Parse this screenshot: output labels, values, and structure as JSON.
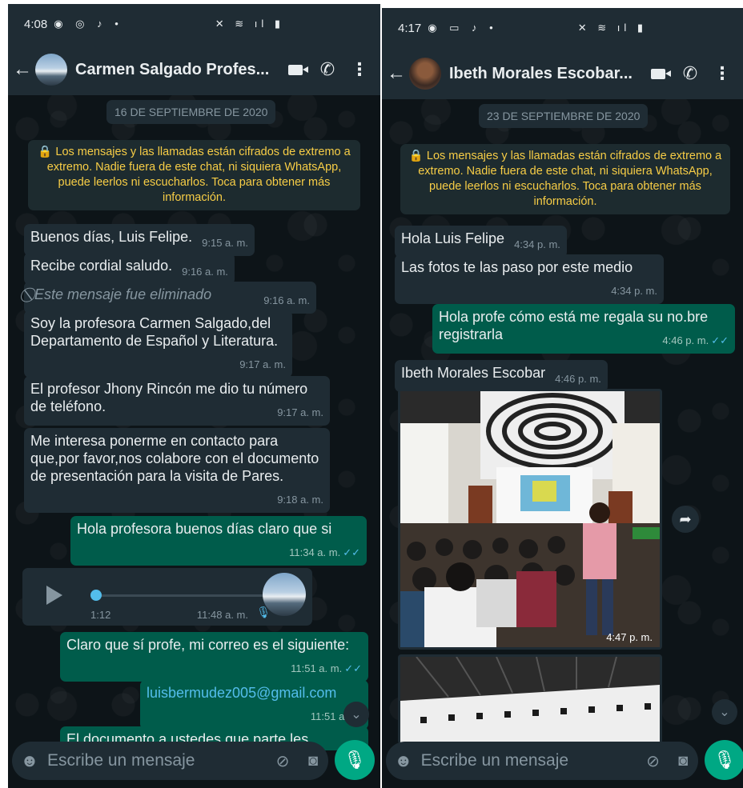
{
  "left": {
    "status_time": "4:08",
    "contact_name": "Carmen Salgado Profes...",
    "date_label": "16 DE SEPTIEMBRE DE 2020",
    "encryption_note": "🔒 Los mensajes y las llamadas están cifrados de extremo a extremo. Nadie fuera de este chat, ni siquiera WhatsApp, puede leerlos ni escucharlos. Toca para obtener más información.",
    "messages": [
      {
        "dir": "in",
        "text": "Buenos días, Luis Felipe.",
        "time": "9:15 a. m."
      },
      {
        "dir": "in",
        "text": "Recibe cordial saludo.",
        "time": "9:16 a. m."
      },
      {
        "dir": "in",
        "text": "⃠ Este mensaje fue eliminado",
        "time": "9:16 a. m."
      },
      {
        "dir": "in",
        "text": "Soy la profesora Carmen Salgado,del Departamento de Español y Literatura.",
        "time": "9:17 a. m."
      },
      {
        "dir": "in",
        "text": "El profesor Jhony Rincón me dio tu número de teléfono.",
        "time": "9:17 a. m."
      },
      {
        "dir": "in",
        "text": "Me interesa ponerme en contacto para que,por favor,nos colabore con el documento de presentación para la visita de Pares.",
        "time": "9:18 a. m."
      },
      {
        "dir": "out",
        "text": "Hola profesora buenos días claro que si",
        "time": "11:34 a. m."
      },
      {
        "dir": "out",
        "text": "Claro que sí profe, mi correo es el siguiente:",
        "time": "11:51 a. m."
      },
      {
        "dir": "out",
        "text": "luisbermudez005@gmail.com",
        "time": "11:51 a. m."
      },
      {
        "dir": "out",
        "text": "El documento a ustedes que parte les",
        "time": ""
      }
    ],
    "audio": {
      "duration": "1:12",
      "time": "11:48 a. m."
    },
    "composer_placeholder": "Escribe un mensaje"
  },
  "right": {
    "status_time": "4:17",
    "contact_name": "Ibeth Morales Escobar...",
    "date_label": "23 DE SEPTIEMBRE DE 2020",
    "encryption_note": "🔒 Los mensajes y las llamadas están cifrados de extremo a extremo. Nadie fuera de este chat, ni siquiera WhatsApp, puede leerlos ni escucharlos. Toca para obtener más información.",
    "messages": [
      {
        "dir": "in",
        "text": "Hola Luis Felipe",
        "time": "4:34 p. m."
      },
      {
        "dir": "in",
        "text": "Las fotos te las paso por este medio",
        "time": "4:34 p. m."
      },
      {
        "dir": "out",
        "text": "Hola profe cómo está me regala su no.bre registrarla",
        "time": "4:46 p. m."
      },
      {
        "dir": "in",
        "text": "Ibeth Morales Escobar",
        "time": "4:46 p. m."
      }
    ],
    "photo_time": "4:47 p. m.",
    "composer_placeholder": "Escribe un mensaje"
  },
  "ticks": "✓✓"
}
